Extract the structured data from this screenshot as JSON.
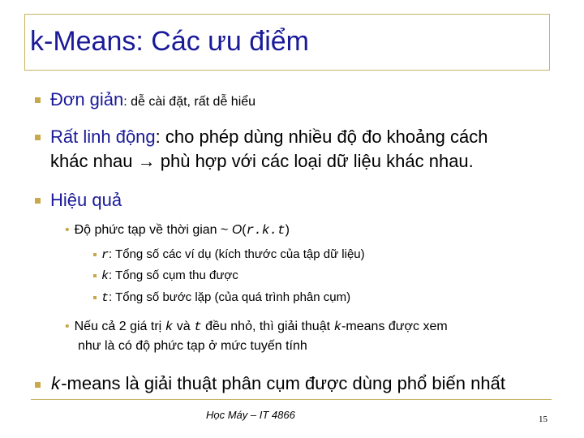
{
  "title": "k-Means: Các ưu điểm",
  "bullets": {
    "b1": {
      "head": "Đơn giản",
      "rest": ": dễ cài đặt, rất dễ hiểu"
    },
    "b2": {
      "head": "Rất linh động",
      "rest1": ": cho phép dùng nhiều độ đo khoảng cách",
      "line2": "khác nhau → phù hợp với các loại dữ liệu khác nhau."
    },
    "b3": {
      "head": "Hiệu quả"
    },
    "sub1": {
      "text": "Độ phức tạp về thời gian  ~ ",
      "O": "O",
      "formula": "r.k.t"
    },
    "sub1a": {
      "var": "r",
      "text": ":  Tổng số các ví dụ (kích thước của tập dữ liệu)"
    },
    "sub1b": {
      "var": "k",
      "text": ":  Tổng số cụm thu được"
    },
    "sub1c": {
      "var": "t",
      "text": ":  Tổng số bước lặp (của quá trình phân cụm)"
    },
    "sub2": {
      "p1": "Nếu cả 2 giá trị ",
      "k": "k",
      "p2": " và ",
      "t": "t",
      "p3": " đều nhỏ, thì giải thuật ",
      "k2": "k",
      "p4": "-means được xem",
      "line2": "như là có độ phức tạp ở mức tuyến tính"
    },
    "b4": {
      "k": "k",
      "rest": "-means là giải thuật phân cụm được dùng phổ biến nhất"
    }
  },
  "footer": "Học Máy – IT 4866",
  "page_number": "15",
  "colors": {
    "title": "#1a1a99",
    "bullet": "#c8a84b",
    "rule": "#c9b35e"
  }
}
